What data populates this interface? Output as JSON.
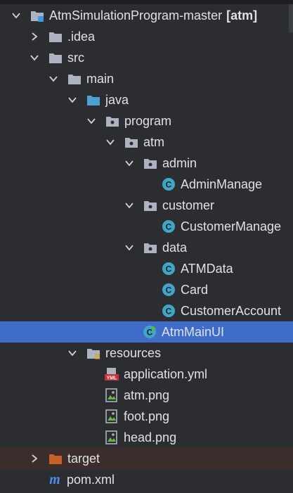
{
  "project_tree": {
    "root": {
      "name": "AtmSimulationProgram-master",
      "module": "[atm]"
    },
    "idea": ".idea",
    "src": "src",
    "main": "main",
    "java": "java",
    "program": "program",
    "atm": "atm",
    "admin": "admin",
    "admin_manage": "AdminManage",
    "customer": "customer",
    "customer_manage": "CustomerManage",
    "data": "data",
    "atm_data": "ATMData",
    "card": "Card",
    "customer_account": "CustomerAccount",
    "atm_main_ui": "AtmMainUI",
    "resources": "resources",
    "application_yml": "application.yml",
    "atm_png": "atm.png",
    "foot_png": "foot.png",
    "head_png": "head.png",
    "target": "target",
    "pom_xml": "pom.xml"
  },
  "icons": {
    "yml_badge": "YML",
    "pom_glyph": "m",
    "class_glyph": "C"
  },
  "colors": {
    "background": "#2b2d30",
    "selection": "#3d6dc9",
    "class_icon": "#3fa6c8",
    "folder": "#aeb3c2",
    "source_folder": "#4f9fd0",
    "target_folder": "#c75f2a",
    "excluded_row": "#3b2d2c",
    "pom_icon": "#4c8fe8"
  }
}
